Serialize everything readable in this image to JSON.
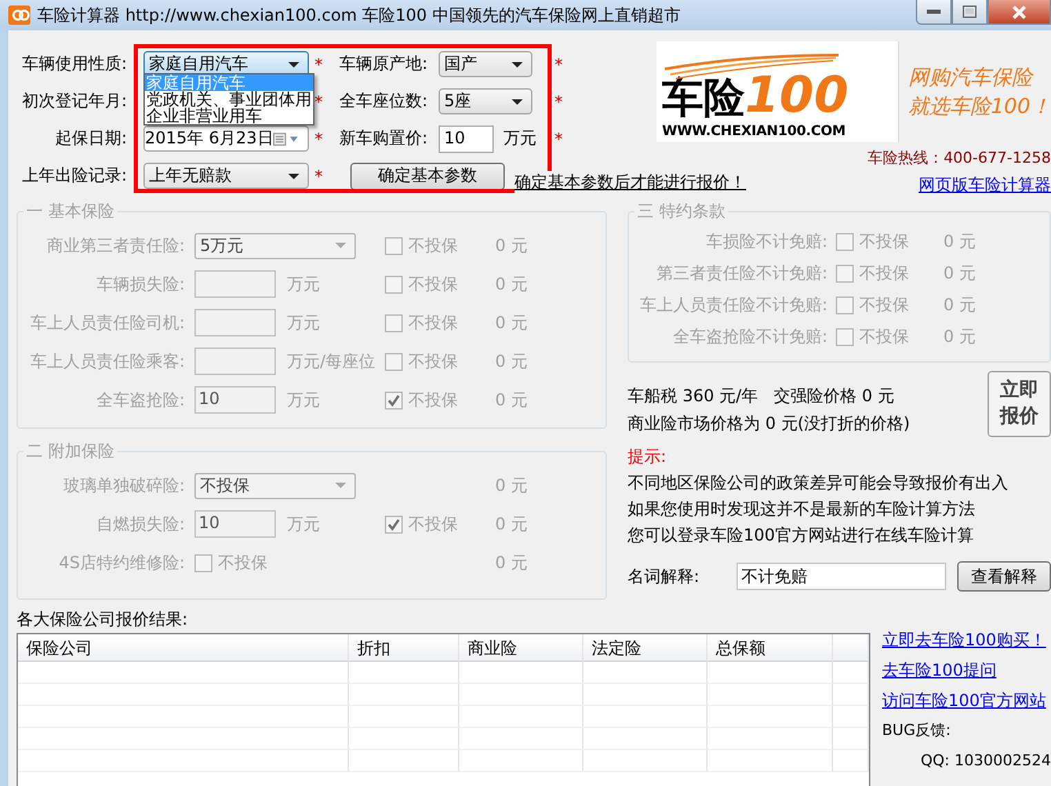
{
  "window": {
    "title": "车险计算器 http://www.chexian100.com 车险100 中国领先的汽车保险网上直销超市"
  },
  "basic": {
    "fields": [
      {
        "kind": "select",
        "label": "车辆使用性质:",
        "value": "家庭自用汽车",
        "star": "*",
        "open": true
      },
      {
        "kind": "select",
        "label": "车辆原产地:",
        "value": "国产",
        "star": "*",
        "open": false
      },
      {
        "kind": "covered",
        "label": "初次登记年月:",
        "star": "*"
      },
      {
        "kind": "select",
        "label": "全车座位数:",
        "value": "5座",
        "star": "*",
        "open": false
      },
      {
        "kind": "date",
        "label": "起保日期:",
        "value": "2015年  6月23日",
        "star": "*"
      },
      {
        "kind": "input",
        "label": "新车购置价:",
        "value": "10",
        "unit": "万元",
        "star": "*"
      },
      {
        "kind": "select",
        "label": "上年出险记录:",
        "value": "上年无赔款",
        "star": "*",
        "open": false
      },
      {
        "kind": "button",
        "label": "确定基本参数"
      }
    ],
    "dropdown": [
      {
        "label": "家庭自用汽车",
        "selected": true
      },
      {
        "label": "党政机关、事业团体用",
        "selected": false
      },
      {
        "label": "企业非营业用车",
        "selected": false
      }
    ],
    "notice": "确定基本参数后才能进行报价！"
  },
  "logo": {
    "name": "车险",
    "number": "100",
    "site": "WWW.CHEXIAN100.COM",
    "slogan": [
      "网购汽车保险",
      "就选车险100！"
    ]
  },
  "hotline": "车险热线：400-677-1258",
  "web_link": "网页版车险计算器",
  "groups": [
    {
      "title": "一 基本保险",
      "rows": [
        {
          "kind": "select",
          "label": "商业第三者责任险:",
          "value": "5万元",
          "waive": {
            "label": "不投保",
            "checked": false
          },
          "amount": "0 元"
        },
        {
          "kind": "input",
          "label": "车辆损失险:",
          "unit": "万元",
          "waive": {
            "label": "不投保",
            "checked": false
          },
          "amount": "0 元"
        },
        {
          "kind": "input",
          "label": "车上人员责任险司机:",
          "unit": "万元",
          "waive": {
            "label": "不投保",
            "checked": false
          },
          "amount": "0 元"
        },
        {
          "kind": "input",
          "label": "车上人员责任险乘客:",
          "unit": "万元/每座位",
          "waive": {
            "label": "不投保",
            "checked": false
          },
          "amount": "0 元"
        },
        {
          "kind": "input",
          "label": "全车盗抢险:",
          "value": "10",
          "unit": "万元",
          "waive": {
            "label": "不投保",
            "checked": true
          },
          "amount": "0 元"
        }
      ]
    },
    {
      "title": "二 附加保险",
      "rows": [
        {
          "kind": "select",
          "label": "玻璃单独破碎险:",
          "value": "不投保",
          "amount": "0 元"
        },
        {
          "kind": "input",
          "label": "自燃损失险:",
          "value": "10",
          "unit": "万元",
          "waive": {
            "label": "不投保",
            "checked": true
          },
          "amount": "0 元"
        },
        {
          "kind": "checkbox",
          "label": "4S店特约维修险:",
          "waive": {
            "label": "不投保",
            "checked": false
          },
          "amount": "0 元"
        }
      ]
    },
    {
      "title": "三 特约条款",
      "rows": [
        {
          "kind": "plain",
          "label": "车损险不计免赔:",
          "waive": {
            "label": "不投保",
            "checked": false
          },
          "amount": "0 元"
        },
        {
          "kind": "plain",
          "label": "第三者责任险不计免赔:",
          "waive": {
            "label": "不投保",
            "checked": false
          },
          "amount": "0 元"
        },
        {
          "kind": "plain",
          "label": "车上人员责任险不计免赔:",
          "waive": {
            "label": "不投保",
            "checked": false
          },
          "amount": "0 元"
        },
        {
          "kind": "plain",
          "label": "全车盗抢险不计免赔:",
          "waive": {
            "label": "不投保",
            "checked": false
          },
          "amount": "0 元"
        }
      ]
    }
  ],
  "summary": {
    "tax": "车船税 360 元/年   交强险价格 0 元",
    "market": "商业险市场价格为 0 元(没打折的价格)",
    "quote_button": "立即报价"
  },
  "tips": {
    "title": "提示:",
    "lines": [
      "不同地区保险公司的政策差异可能会导致报价有出入",
      "如果您使用时发现这并不是最新的车险计算方法",
      "您可以登录车险100官方网站进行在线车险计算"
    ]
  },
  "glossary": {
    "label": "名词解释:",
    "value": "不计免赔",
    "button": "查看解释"
  },
  "results": {
    "title": "各大保险公司报价结果:",
    "columns": [
      "保险公司",
      "折扣",
      "商业险",
      "法定险",
      "总保额"
    ]
  },
  "links": [
    "立即去车险100购买！",
    "去车险100提问",
    "访问车险100官方网站"
  ],
  "feedback": {
    "title": "BUG反馈:",
    "qq": "QQ: 1030002524"
  }
}
